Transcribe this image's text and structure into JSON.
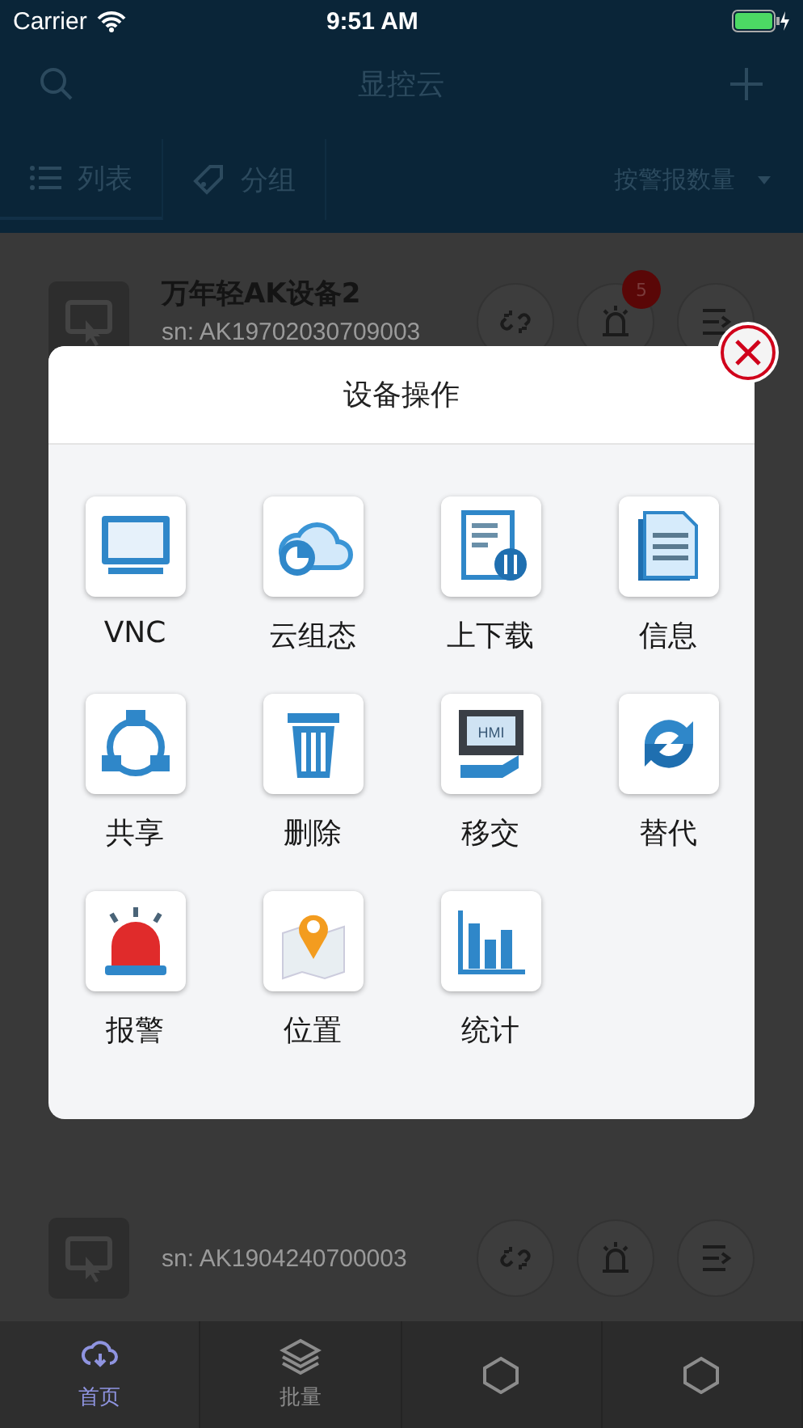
{
  "status_bar": {
    "carrier": "Carrier",
    "time": "9:51 AM",
    "battery": {
      "level": 1
    }
  },
  "nav": {
    "title": "显控云"
  },
  "toolbar": {
    "tabs": [
      {
        "label": "列表",
        "selected": true
      },
      {
        "label": "分组",
        "selected": false
      }
    ],
    "sort": "按警报数量"
  },
  "devices": [
    {
      "name": "万年轻AK设备2",
      "sn": "sn: AK19702030709003",
      "alarm_badge": "5"
    },
    {
      "sn": "sn: AK1904240700003"
    }
  ],
  "dialog": {
    "title": "设备操作",
    "actions": [
      {
        "label": "VNC"
      },
      {
        "label": "云组态"
      },
      {
        "label": "上下载"
      },
      {
        "label": "信息"
      },
      {
        "label": "共享"
      },
      {
        "label": "删除"
      },
      {
        "label": "移交",
        "icon_text": "HMI"
      },
      {
        "label": "替代"
      },
      {
        "label": "报警"
      },
      {
        "label": "位置"
      },
      {
        "label": "统计"
      }
    ]
  },
  "tab_bar": [
    {
      "label": "首页",
      "selected": true
    },
    {
      "label": "批量",
      "selected": false
    },
    {
      "selected": false
    },
    {
      "selected": false
    }
  ]
}
